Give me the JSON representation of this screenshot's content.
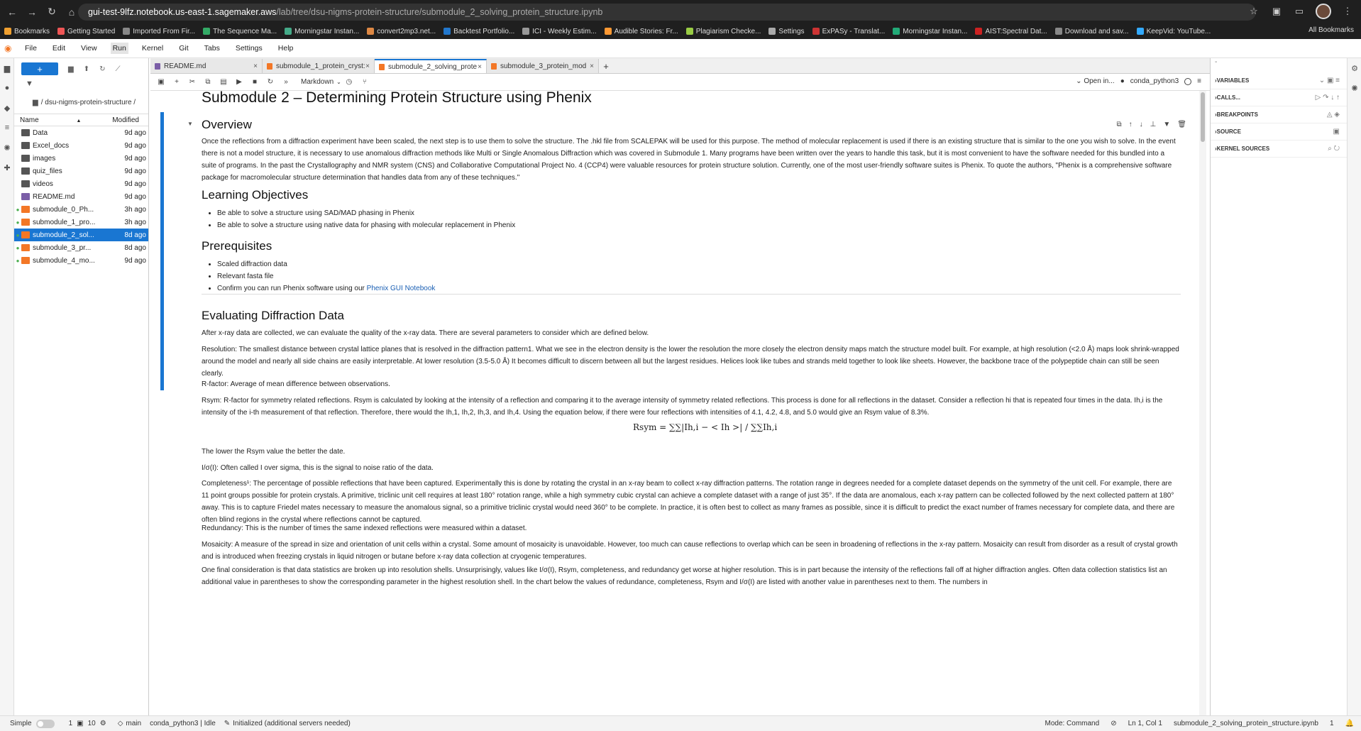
{
  "browser": {
    "url_host": "gui-test-9lfz.notebook.us-east-1.sagemaker.aws",
    "url_path": "/lab/tree/dsu-nigms-protein-structure/submodule_2_solving_protein_structure.ipynb",
    "bookmarks": [
      "Bookmarks",
      "Getting Started",
      "Imported From Fir...",
      "The Sequence Ma...",
      "Morningstar Instan...",
      "convert2mp3.net...",
      "Backtest Portfolio...",
      "ICI - Weekly Estim...",
      "Audible Stories: Fr...",
      "Plagiarism Checke...",
      "Settings",
      "ExPASy - Translat...",
      "Morningstar Instan...",
      "AIST:Spectral Dat...",
      "Download and sav...",
      "KeepVid: YouTube..."
    ],
    "all_bookmarks": "All Bookmarks"
  },
  "menu": [
    "File",
    "Edit",
    "View",
    "Run",
    "Kernel",
    "Git",
    "Tabs",
    "Settings",
    "Help"
  ],
  "filebrowser": {
    "breadcrumb": "/ dsu-nigms-protein-structure /",
    "col_name": "Name",
    "col_modified": "Modified",
    "rows": [
      {
        "name": "Data",
        "modified": "9d ago",
        "kind": "folder"
      },
      {
        "name": "Excel_docs",
        "modified": "9d ago",
        "kind": "folder"
      },
      {
        "name": "images",
        "modified": "9d ago",
        "kind": "folder"
      },
      {
        "name": "quiz_files",
        "modified": "9d ago",
        "kind": "folder"
      },
      {
        "name": "videos",
        "modified": "9d ago",
        "kind": "folder"
      },
      {
        "name": "README.md",
        "modified": "9d ago",
        "kind": "md"
      },
      {
        "name": "submodule_0_Ph...",
        "modified": "3h ago",
        "kind": "nb"
      },
      {
        "name": "submodule_1_pro...",
        "modified": "3h ago",
        "kind": "nb"
      },
      {
        "name": "submodule_2_sol...",
        "modified": "8d ago",
        "kind": "nb"
      },
      {
        "name": "submodule_3_pr...",
        "modified": "8d ago",
        "kind": "nb"
      },
      {
        "name": "submodule_4_mo...",
        "modified": "9d ago",
        "kind": "nb"
      }
    ]
  },
  "tabs": [
    "README.md",
    "submodule_1_protein_cryst:",
    "submodule_2_solving_prote",
    "submodule_3_protein_mod"
  ],
  "nbtoolbar": {
    "celltype": "Markdown",
    "open_in": "Open in...",
    "kernel": "conda_python3"
  },
  "notebook": {
    "title": "Submodule 2 – Determining Protein Structure using Phenix",
    "overview_h": "Overview",
    "overview_p": "Once the reflections from a diffraction experiment have been scaled, the next step is to use them to solve the structure. The .hkl file from SCALEPAK will be used for this purpose. The method of molecular replacement is used if there is an existing structure that is similar to the one you wish to solve. In the event there is not a model structure, it is necessary to use anomalous diffraction methods like Multi or Single Anomalous Diffraction which was covered in Submodule 1. Many programs have been written over the years to handle this task, but it is most convenient to have the software needed for this bundled into a suite of programs. In the past the Crystallography and NMR system (CNS) and Collaborative Computational Project No. 4 (CCP4) were valuable resources for protein structure solution. Currently, one of the most user-friendly software suites is Phenix. To quote the authors, \"Phenix is a comprehensive software package for macromolecular structure determination that handles data from any of these techniques.\"",
    "lo_h": "Learning Objectives",
    "lo_items": [
      "Be able to solve a structure using SAD/MAD phasing in Phenix",
      "Be able to solve a structure using native data for phasing with molecular replacement in Phenix"
    ],
    "pre_h": "Prerequisites",
    "pre_items": [
      "Scaled diffraction data",
      "Relevant fasta file"
    ],
    "pre_last_text": "Confirm you can run Phenix software using our ",
    "pre_last_link": "Phenix GUI Notebook",
    "eval_h": "Evaluating Diffraction Data",
    "p1": "After x-ray data are collected, we can evaluate the quality of the x-ray data. There are several parameters to consider which are defined below.",
    "p2": "Resolution: The smallest distance between crystal lattice planes that is resolved in the diffraction pattern1. What we see in the electron density is the lower the resolution the more closely the electron density maps match the structure model built. For example, at high resolution (<2.0 Å) maps look shrink-wrapped around the model and nearly all side chains are easily interpretable. At lower resolution (3.5-5.0 Å) It becomes difficult to discern between all but the largest residues. Helices look like tubes and strands meld together to look like sheets. However, the backbone trace of the polypeptide chain can still be seen clearly.",
    "p3": "R-factor: Average of mean difference between observations.",
    "p4": "Rsym: R-factor for symmetry related reflections. Rsym is calculated by looking at the intensity of a reflection and comparing it to the average intensity of symmetry related reflections. This process is done for all reflections in the dataset. Consider a reflection hi that is repeated four times in the data. Ih,i is the intensity of the i-th measurement of that reflection. Therefore, there would the Ih,1, Ih,2, Ih,3, and Ih,4. Using the equation below, if there were four reflections with intensities of 4.1, 4.2, 4.8, and 5.0 would give an Rsym value of 8.3%.",
    "formula": "Rsym = ∑∑|Ih,i − < Ih >| / ∑∑Ih,i",
    "p5": "The lower the Rsym value the better the date.",
    "p6": "I/σ(I): Often called I over sigma, this is the signal to noise ratio of the data.",
    "p7": "Completeness¹: The percentage of possible reflections that have been captured. Experimentally this is done by rotating the crystal in an x-ray beam to collect x-ray diffraction patterns. The rotation range in degrees needed for a complete dataset depends on the symmetry of the unit cell. For example, there are 11 point groups possible for protein crystals. A primitive, triclinic unit cell requires at least 180° rotation range, while a high symmetry cubic crystal can achieve a complete dataset with a range of just 35°. If the data are anomalous, each x-ray pattern can be collected followed by the next collected pattern at 180° away. This is to capture Friedel mates necessary to measure the anomalous signal, so a primitive triclinic crystal would need 360° to be complete. In practice, it is often best to collect as many frames as possible, since it is difficult to predict the exact number of frames necessary for complete data, and there are often blind regions in the crystal where reflections cannot be captured.",
    "p8": "Redundancy: This is the number of times the same indexed reflections were measured within a dataset.",
    "p9": "Mosaicity: A measure of the spread in size and orientation of unit cells within a crystal. Some amount of mosaicity is unavoidable. However, too much can cause reflections to overlap which can be seen in broadening of reflections in the x-ray pattern. Mosaicity can result from disorder as a result of crystal growth and is introduced when freezing crystals in liquid nitrogen or butane before x-ray data collection at cryogenic temperatures.",
    "p10": "One final consideration is that data statistics are broken up into resolution shells. Unsurprisingly, values like I/σ(I), Rsym, completeness, and redundancy get worse at higher resolution. This is in part because the intensity of the reflections fall off at higher diffraction angles. Often data collection statistics list an additional value in parentheses to show the corresponding parameter in the highest resolution shell. In the chart below the values of redundance, completeness, Rsym and I/σ(I) are listed with another value in parentheses next to them. The numbers in"
  },
  "debugger": [
    "VARIABLES",
    "CALLS...",
    "BREAKPOINTS",
    "SOURCE",
    "KERNEL SOURCES"
  ],
  "statusbar": {
    "mode_label": "Simple",
    "n1": "1",
    "n2": "10",
    "branch": "main",
    "kernel_status": "conda_python3 | Idle",
    "init": "Initialized (additional servers needed)",
    "mode": "Mode: Command",
    "pos": "Ln 1, Col 1",
    "file": "submodule_2_solving_protein_structure.ipynb",
    "count": "1"
  }
}
